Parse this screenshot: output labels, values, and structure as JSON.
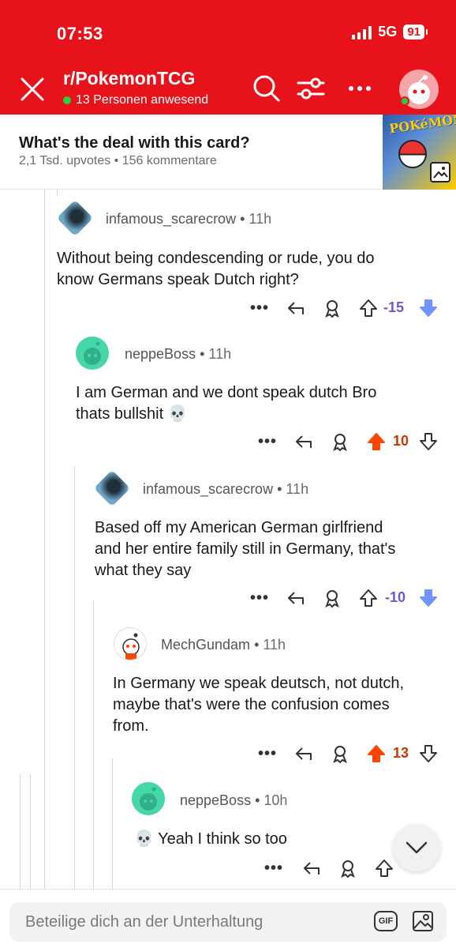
{
  "status": {
    "time": "07:53",
    "network": "5G",
    "battery": "91"
  },
  "header": {
    "subreddit": "r/PokemonTCG",
    "online_text": "13 Personen anwesend"
  },
  "post": {
    "title": "What's the deal with this card?",
    "meta": "2,1 Tsd. upvotes • 156 kommentare",
    "thumbnail_text": "POKéMON"
  },
  "comments": [
    {
      "author": "infamous_scarecrow",
      "time": "11h",
      "text_1": "Without being condescending or rude, you do",
      "text_2": "know Germans speak Dutch right?",
      "score": "-15",
      "vote": "down"
    },
    {
      "author": "neppeBoss",
      "time": "11h",
      "text_1": "I am German and we dont speak dutch Bro",
      "text_2": "thats bullshit 💀",
      "score": "10",
      "vote": "up"
    },
    {
      "author": "infamous_scarecrow",
      "time": "11h",
      "text_1": "Based off my American German girlfriend",
      "text_2": "and her entire family still in Germany, that's",
      "text_3": "what they say",
      "score": "-10",
      "vote": "down"
    },
    {
      "author": "MechGundam",
      "time": "11h",
      "text_1": "In Germany we speak deutsch, not dutch,",
      "text_2": "maybe that's were the confusion comes",
      "text_3": "from.",
      "score": "13",
      "vote": "up"
    },
    {
      "author": "neppeBoss",
      "time": "10h",
      "text_1": "💀 Yeah I think so too"
    }
  ],
  "composer": {
    "placeholder": "Beteilige dich an der Unterhaltung",
    "gif_label": "GIF"
  },
  "colors": {
    "brand_red": "#e8131a",
    "upvote": "#ff4500",
    "downvote": "#7193ff",
    "downvote_text": "#6a5acd"
  }
}
